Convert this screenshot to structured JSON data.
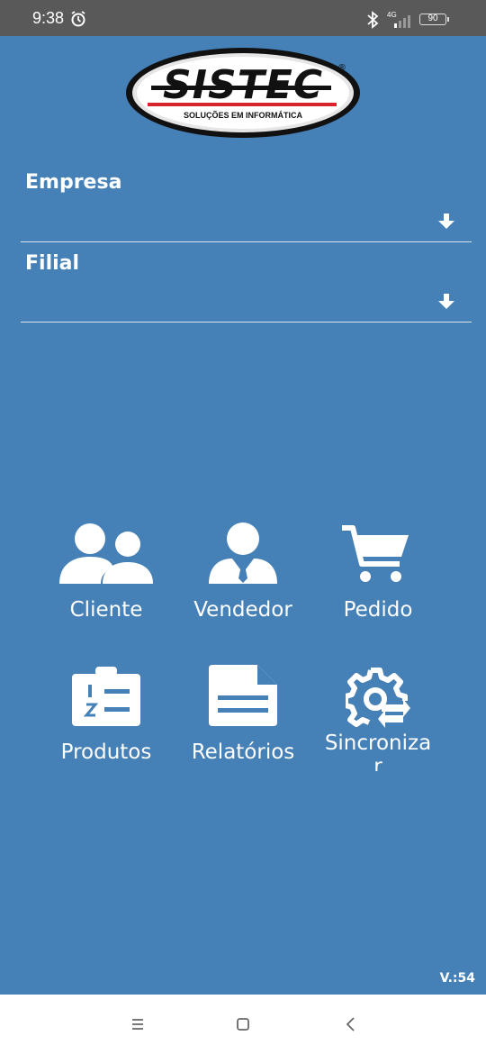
{
  "status_bar": {
    "time": "9:38",
    "network": "4G",
    "battery": "90",
    "icons": [
      "alarm-icon",
      "bluetooth-icon",
      "signal-icon",
      "battery-icon"
    ]
  },
  "logo": {
    "brand": "SISTEC",
    "tagline": "SOLUÇÕES EM INFORMÁTICA",
    "registered": "®"
  },
  "form": {
    "empresa_label": "Empresa",
    "empresa_value": "",
    "filial_label": "Filial",
    "filial_value": ""
  },
  "menu": {
    "cliente": "Cliente",
    "vendedor": "Vendedor",
    "pedido": "Pedido",
    "produtos": "Produtos",
    "relatorios": "Relatórios",
    "sincronizar_line1": "Sincroniza",
    "sincronizar_line2": "r"
  },
  "version": "V.:54",
  "colors": {
    "background": "#4580b6",
    "status_bar": "#595959",
    "text": "#ffffff",
    "nav_bar": "#ffffff",
    "logo_red": "#d7262b"
  }
}
